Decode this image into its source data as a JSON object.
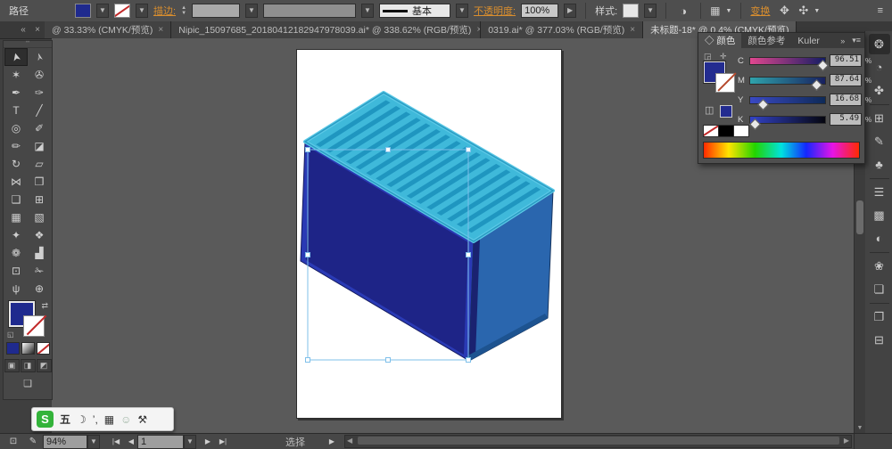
{
  "control_bar": {
    "object_type": "路径",
    "stroke_label": "描边:",
    "brush_style": "基本",
    "opacity_label": "不透明度:",
    "opacity_value": "100%",
    "style_label": "样式:",
    "transform_link": "变换",
    "icons": {
      "fill_dd": "▼",
      "stroke_dd": "▼",
      "stepper_up": "▲",
      "stepper_down": "▼",
      "recolor": "◑",
      "align_grid": "▦",
      "grid_dd": "▼",
      "free_transform": "✥",
      "shape_modes": "✣",
      "shape_dd": "▼",
      "panel_menu": "≡"
    }
  },
  "tab_bar": {
    "overflow_left": "«",
    "close_group": "×",
    "tabs": [
      {
        "title": "@ 33.33% (CMYK/预览)",
        "close": "×"
      },
      {
        "title": "Nipic_15097685_20180412182947978039.ai* @ 338.62% (RGB/预览)",
        "close": "×"
      },
      {
        "title": "0319.ai* @ 377.03% (RGB/预览)",
        "close": "×"
      },
      {
        "title": "未标题-18* @ 0.4% (CMYK/预览)",
        "close": "×"
      }
    ]
  },
  "toolbox": {
    "grip": "••",
    "tools": [
      {
        "name": "selection-tool",
        "g": "➤"
      },
      {
        "name": "direct-selection-tool",
        "g": "➢"
      },
      {
        "name": "magic-wand-tool",
        "g": "✶"
      },
      {
        "name": "lasso-tool",
        "g": "✇"
      },
      {
        "name": "pen-tool",
        "g": "✒"
      },
      {
        "name": "add-anchor-point-tool",
        "g": "✑"
      },
      {
        "name": "type-tool",
        "g": "T"
      },
      {
        "name": "line-segment-tool",
        "g": "╱"
      },
      {
        "name": "ellipse-tool",
        "g": "◎"
      },
      {
        "name": "paintbrush-tool",
        "g": "✐"
      },
      {
        "name": "pencil-tool",
        "g": "✏"
      },
      {
        "name": "eraser-tool",
        "g": "◪"
      },
      {
        "name": "rotate-tool",
        "g": "↻"
      },
      {
        "name": "scale-tool",
        "g": "▱"
      },
      {
        "name": "width-tool",
        "g": "⋈"
      },
      {
        "name": "free-transform-tool",
        "g": "❒"
      },
      {
        "name": "shape-builder-tool",
        "g": "❑"
      },
      {
        "name": "perspective-grid-tool",
        "g": "⊞"
      },
      {
        "name": "mesh-tool",
        "g": "▦"
      },
      {
        "name": "gradient-tool",
        "g": "▧"
      },
      {
        "name": "eyedropper-tool",
        "g": "✦"
      },
      {
        "name": "blend-tool",
        "g": "❖"
      },
      {
        "name": "symbol-sprayer-tool",
        "g": "❁"
      },
      {
        "name": "column-graph-tool",
        "g": "▟"
      },
      {
        "name": "artboard-tool",
        "g": "⊡"
      },
      {
        "name": "slice-tool",
        "g": "✁"
      },
      {
        "name": "hand-tool",
        "g": "ψ"
      },
      {
        "name": "zoom-tool",
        "g": "⊕"
      }
    ],
    "swap_icon": "⇄",
    "mini_icon": "◱",
    "mode_icons": [
      "▣",
      "◨",
      "◩"
    ],
    "screen_mode_icon": "❏",
    "fill_color": "#1f2a8e"
  },
  "color_panel": {
    "tabs": [
      {
        "label": "◇ 颜色"
      },
      {
        "label": "颜色参考"
      },
      {
        "label": "Kuler"
      }
    ],
    "collapse_icon": "»",
    "menu_icon": "▾≡",
    "option_icon_1": "◲",
    "option_icon_2": "✛",
    "cube_icon": "◫",
    "fill_color": "#232c90",
    "sliders": [
      {
        "label": "C",
        "value": "96.51",
        "unit": "%"
      },
      {
        "label": "M",
        "value": "87.64",
        "unit": "%"
      },
      {
        "label": "Y",
        "value": "16.68",
        "unit": "%"
      },
      {
        "label": "K",
        "value": "5.49",
        "unit": "%"
      }
    ]
  },
  "dock": {
    "icons": [
      {
        "name": "color-panel-icon",
        "g": "❂"
      },
      {
        "name": "color-guide-panel-icon",
        "g": "◔"
      },
      {
        "name": "kuler-panel-icon",
        "g": "✤"
      },
      {
        "name": "navigator-panel-icon",
        "g": "⊞"
      },
      {
        "name": "brushes-panel-icon",
        "g": "✎"
      },
      {
        "name": "symbols-panel-icon",
        "g": "♣"
      },
      {
        "name": "stroke-panel-icon",
        "g": "☰"
      },
      {
        "name": "gradient-panel-icon",
        "g": "▩"
      },
      {
        "name": "transparency-panel-icon",
        "g": "◐"
      },
      {
        "name": "appearance-panel-icon",
        "g": "❀"
      },
      {
        "name": "graphic-styles-panel-icon",
        "g": "❏"
      },
      {
        "name": "layers-panel-icon",
        "g": "❐"
      },
      {
        "name": "artboards-panel-icon",
        "g": "⊟"
      }
    ]
  },
  "status_bar": {
    "history_icon": "⊡",
    "edit_icon": "✎",
    "zoom_value": "94%",
    "zoom_dd": "▼",
    "nav_first": "|◀",
    "nav_prev": "◀",
    "artboard_number": "1",
    "artboard_dd": "▼",
    "nav_next": "▶",
    "nav_last": "▶|",
    "tool_name": "选择",
    "divider_arrow": "▶",
    "scroll_left": "◀",
    "scroll_right": "▶",
    "scroll_up": "▲",
    "scroll_down": "▼"
  },
  "ime_bar": {
    "logo": "S",
    "mode": "五",
    "moon_icon": "☽",
    "punct_icon": "’,",
    "keyboard_icon": "▦",
    "user_icon": "☺",
    "wrench_icon": "⚒"
  },
  "artwork": {
    "top_face_color": "#3fb9da",
    "stripe_color": "#1f96c0",
    "top_rim_color": "#5bc9e6",
    "front_face_color": "#1e2487",
    "front_frame_color": "#2a3ab5",
    "right_face_color": "#2a66ae",
    "right_edge_color": "#1a2270",
    "bottom_trim_color": "#1d5390",
    "selection_color": "#7fc0ea"
  }
}
